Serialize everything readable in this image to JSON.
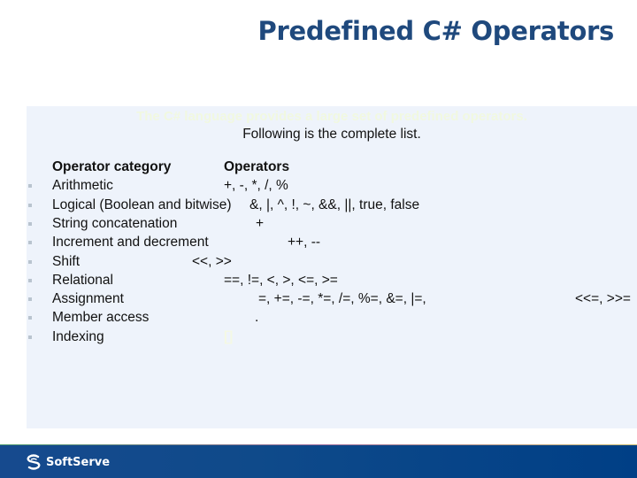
{
  "title": "Predefined C# Operators",
  "panel": {
    "faint_heading": "The C# language provides a large set of predefined operators.",
    "intro": "Following is the complete list.",
    "header": {
      "category": "Operator category",
      "operators": "Operators"
    },
    "rows": [
      {
        "category": "Arithmetic",
        "operators": "+, -, *, /, %"
      },
      {
        "category": "Logical (Boolean and bitwise)",
        "operators": "&, |, ^, !, ~, &&, ||, true, false"
      },
      {
        "category": "String concatenation",
        "operators": "+"
      },
      {
        "category": "Increment and decrement",
        "operators": "++, --"
      },
      {
        "category": "Shift",
        "operators": "<<, >>"
      },
      {
        "category": "Relational",
        "operators": "==, !=, <, >, <=, >="
      },
      {
        "category": "Assignment",
        "operators": "=, +=, -=, *=, /=, %=, &=, |=,",
        "operators_tail": "<<=, >>="
      },
      {
        "category": "Member access",
        "operators": "."
      },
      {
        "category": "Indexing",
        "operators": "[]"
      }
    ]
  },
  "footer": {
    "brand": "SoftServe",
    "logo_icon": "softserve-logo-icon"
  }
}
